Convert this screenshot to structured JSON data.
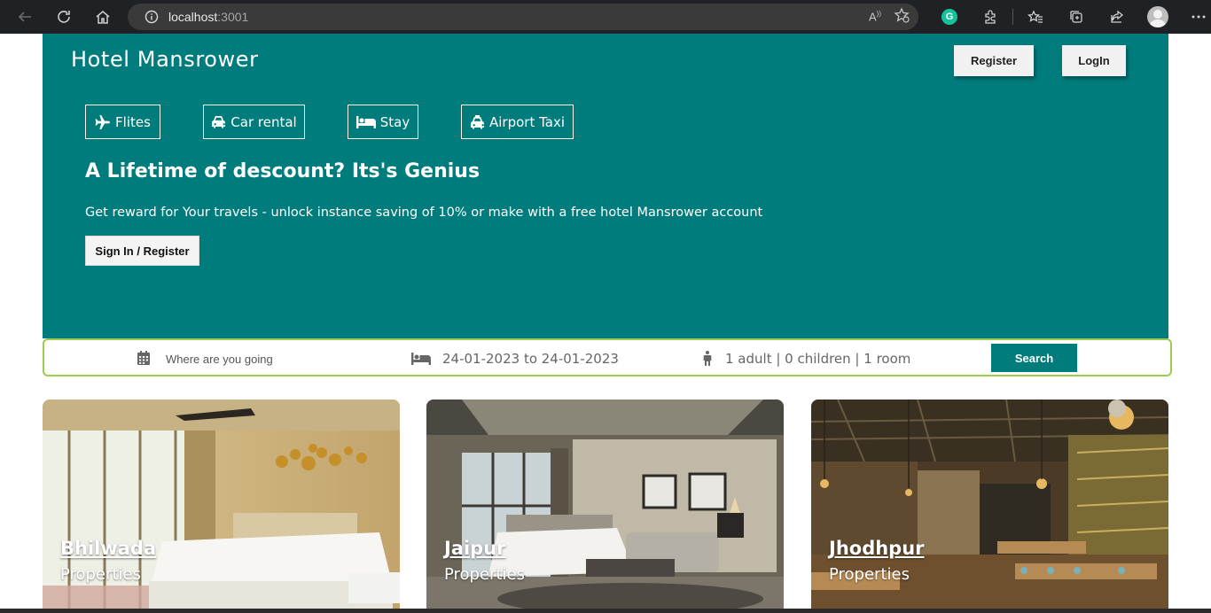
{
  "browser": {
    "url_host": "localhost",
    "url_port": ":3001"
  },
  "header": {
    "brand": "Hotel Mansrower",
    "register_label": "Register",
    "login_label": "LogIn"
  },
  "categories": [
    {
      "label": "Flites",
      "icon": "plane-icon"
    },
    {
      "label": "Car rental",
      "icon": "car-icon"
    },
    {
      "label": "Stay",
      "icon": "bed-icon"
    },
    {
      "label": "Airport Taxi",
      "icon": "taxi-icon"
    }
  ],
  "hero": {
    "headline": "A Lifetime of descount? Its's Genius",
    "subline": "Get reward for Your travels - unlock instance saving of 10% or make with a free hotel Mansrower account",
    "signin_label": "Sign In / Register"
  },
  "search": {
    "destination_placeholder": "Where are you going",
    "date_range": "24-01-2023 to 24-01-2023",
    "guests": "1 adult | 0 children | 1 room",
    "button_label": "Search"
  },
  "cards": [
    {
      "city": "Bhilwada",
      "subtitle": "Properties"
    },
    {
      "city": "Jaipur",
      "subtitle": "Properties"
    },
    {
      "city": "Jhodhpur",
      "subtitle": "Properties"
    }
  ],
  "colors": {
    "brand": "#007c7c",
    "search_border": "#9ccc4f"
  }
}
